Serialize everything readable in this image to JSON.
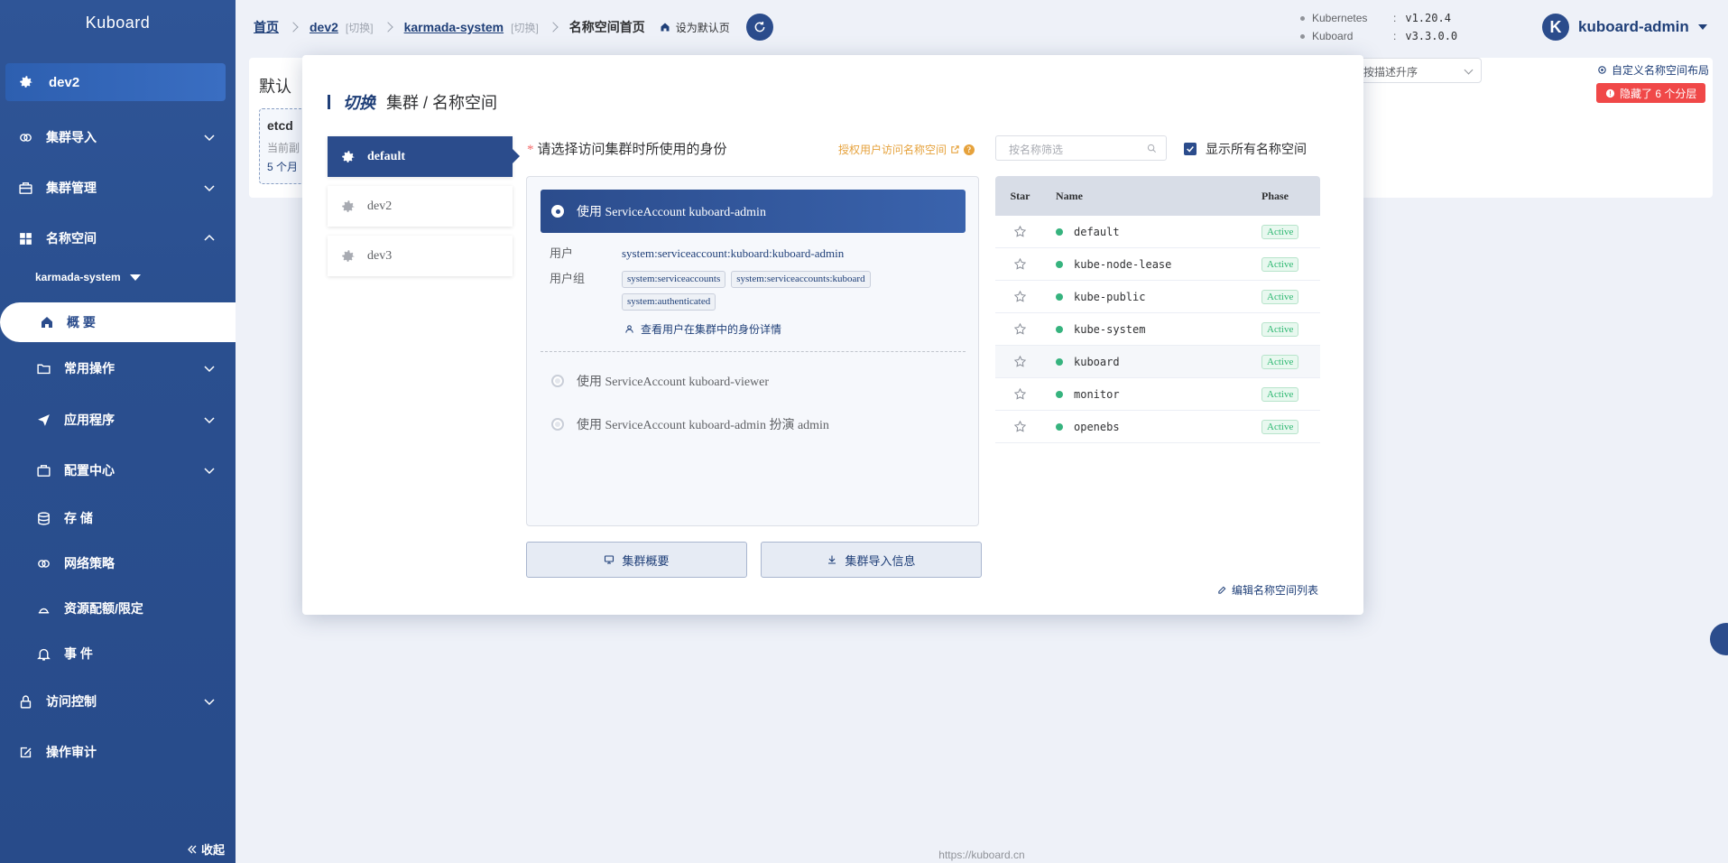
{
  "sidebar": {
    "brand": "Kuboard",
    "cluster": "dev2",
    "menu": {
      "cluster_import": "集群导入",
      "cluster_manage": "集群管理",
      "namespace": "名称空间",
      "ns_selected": "karmada-system",
      "overview": "概 要",
      "common_ops": "常用操作",
      "apps": "应用程序",
      "config_center": "配置中心",
      "storage": "存 储",
      "network_policy": "网络策略",
      "quota": "资源配额/限定",
      "events": "事 件",
      "access_control": "访问控制",
      "audit": "操作审计"
    },
    "collapse": "收起"
  },
  "topbar": {
    "home": "首页",
    "cluster": "dev2",
    "switch": "[切换]",
    "namespace": "karmada-system",
    "page": "名称空间首页",
    "set_default": "设为默认页"
  },
  "versions": {
    "k8s_label": "Kubernetes",
    "k8s_value": "v1.20.4",
    "kuboard_label": "Kuboard",
    "kuboard_value": "v3.3.0.0",
    "sep": ":"
  },
  "user": {
    "initial": "K",
    "name": "kuboard-admin"
  },
  "background": {
    "title": "默认",
    "etcd_title": "etcd",
    "etcd_line1": "当前副",
    "etcd_line2": "5 个月",
    "sort": "按描述升序",
    "layout_link": "自定义名称空间布局",
    "hidden_badge": "隐藏了 6 个分层",
    "footer": "https://kuboard.cn"
  },
  "modal": {
    "title_em": "切换",
    "title": "集群 / 名称空间",
    "clusters": [
      "default",
      "dev2",
      "dev3"
    ],
    "identity_prompt": "请选择访问集群时所使用的身份",
    "auth_link": "授权用户访问名称空间",
    "auth_q": "?",
    "options": [
      "使用 ServiceAccount kuboard-admin",
      "使用 ServiceAccount kuboard-viewer",
      "使用 ServiceAccount kuboard-admin 扮演 admin"
    ],
    "user_label": "用户",
    "user_value": "system:serviceaccount:kuboard:kuboard-admin",
    "group_label": "用户组",
    "groups": [
      "system:serviceaccounts",
      "system:serviceaccounts:kuboard",
      "system:authenticated"
    ],
    "detail_link": "查看用户在集群中的身份详情",
    "btn_overview": "集群概要",
    "btn_import": "集群导入信息",
    "edit_link": "编辑名称空间列表",
    "search_placeholder": "按名称筛选",
    "show_all": "显示所有名称空间",
    "table": {
      "headers": {
        "star": "Star",
        "name": "Name",
        "phase": "Phase"
      },
      "rows": [
        {
          "name": "default",
          "phase": "Active"
        },
        {
          "name": "kube-node-lease",
          "phase": "Active"
        },
        {
          "name": "kube-public",
          "phase": "Active"
        },
        {
          "name": "kube-system",
          "phase": "Active"
        },
        {
          "name": "kuboard",
          "phase": "Active"
        },
        {
          "name": "monitor",
          "phase": "Active"
        },
        {
          "name": "openebs",
          "phase": "Active"
        }
      ]
    }
  },
  "colors": {
    "primary": "#2b4c8c",
    "accent_orange": "#e6a23c",
    "danger": "#f04848",
    "success": "#36b37e"
  }
}
